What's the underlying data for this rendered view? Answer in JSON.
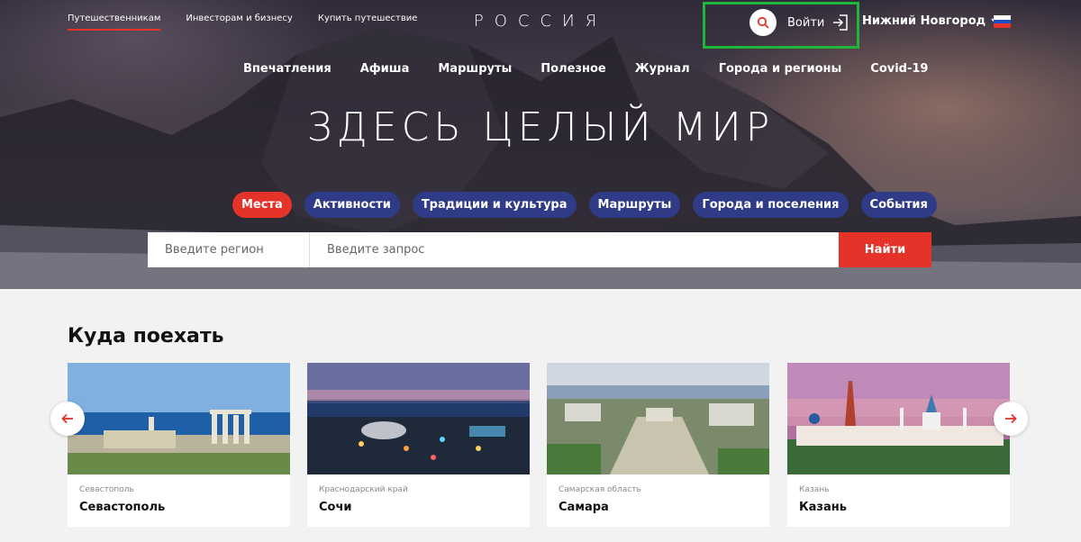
{
  "topnav": {
    "items": [
      "Путешественникам",
      "Инвесторам и бизнесу",
      "Купить путешествие"
    ]
  },
  "logo": "РОССИЯ",
  "auth": {
    "login_label": "Войти",
    "city": "Нижний Новгород"
  },
  "mainnav": {
    "items": [
      "Впечатления",
      "Афиша",
      "Маршруты",
      "Полезное",
      "Журнал",
      "Города и регионы",
      "Covid-19"
    ]
  },
  "headline": "ЗДЕСЬ ЦЕЛЫЙ МИР",
  "chips": {
    "items": [
      "Места",
      "Активности",
      "Традиции и культура",
      "Маршруты",
      "Города и поселения",
      "События"
    ],
    "active": "Места"
  },
  "search": {
    "region_placeholder": "Введите регион",
    "query_placeholder": "Введите запрос",
    "button_label": "Найти"
  },
  "section": {
    "title": "Куда поехать",
    "cards": [
      {
        "region": "Севастополь",
        "name": "Севастополь"
      },
      {
        "region": "Краснодарский край",
        "name": "Сочи"
      },
      {
        "region": "Самарская область",
        "name": "Самара"
      },
      {
        "region": "Казань",
        "name": "Казань"
      }
    ]
  },
  "icons": {
    "search": "search-icon",
    "login": "login-icon",
    "dropdown": "chevron-down-icon",
    "flag": "russia-flag-icon",
    "prev": "arrow-left-icon",
    "next": "arrow-right-icon"
  },
  "colors": {
    "accent_red": "#e6332a",
    "chip_blue": "#2f3b86",
    "highlight_green": "#20b43a",
    "background": "#f2f2f2"
  }
}
